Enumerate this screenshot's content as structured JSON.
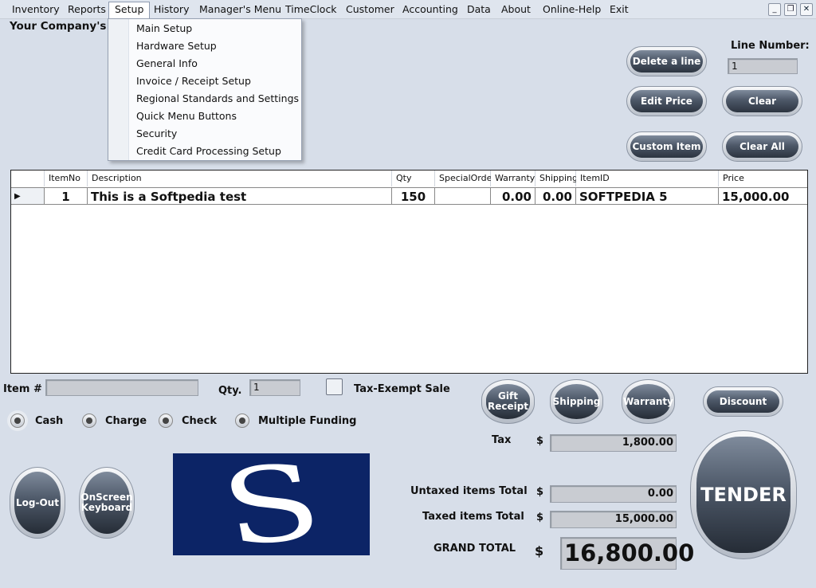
{
  "menu": {
    "items": [
      "Inventory",
      "Reports",
      "Setup",
      "History",
      "Manager's Menu",
      "TimeClock",
      "Customer",
      "Accounting",
      "Data",
      "About",
      "Online-Help",
      "Exit"
    ],
    "active": "Setup"
  },
  "window_controls": {
    "minimize": "_",
    "restore": "❐",
    "close": "✕"
  },
  "setup_menu": [
    "Main Setup",
    "Hardware Setup",
    "General Info",
    "Invoice / Receipt Setup",
    "Regional Standards and Settings",
    "Quick Menu Buttons",
    "Security",
    "Credit Card Processing Setup"
  ],
  "company_name": "Your Company's Na",
  "line_number": {
    "label": "Line Number:",
    "value": "1"
  },
  "buttons": {
    "delete_line": "Delete a line",
    "edit_price": "Edit Price",
    "clear": "Clear",
    "custom_item": "Custom Item",
    "clear_all": "Clear All",
    "gift_receipt": "Gift Receipt",
    "shipping": "Shipping",
    "warranty": "Warranty",
    "discount": "Discount",
    "logout": "Log-Out",
    "onscreen_keyboard": "OnScreen Keyboard",
    "tender": "TENDER"
  },
  "grid": {
    "columns": [
      "ItemNo",
      "Description",
      "Qty",
      "SpecialOrder",
      "Warranty",
      "Shipping",
      "ItemID",
      "Price"
    ],
    "rows": [
      {
        "itemno": "1",
        "description": "This is a Softpedia test",
        "qty": "150",
        "specialorder": "",
        "warranty": "0.00",
        "shipping": "0.00",
        "itemid": "SOFTPEDIA 5",
        "price": "15,000.00"
      }
    ]
  },
  "entry": {
    "item_label": "Item #",
    "item_value": "",
    "qty_label": "Qty.",
    "qty_value": "1",
    "tax_exempt_label": "Tax-Exempt Sale",
    "tax_exempt_checked": false
  },
  "payment": {
    "options": [
      "Cash",
      "Charge",
      "Check",
      "Multiple Funding"
    ],
    "selected": "Cash"
  },
  "totals": {
    "currency": "$",
    "tax_label": "Tax",
    "tax": "1,800.00",
    "untaxed_label": "Untaxed items Total",
    "untaxed": "0.00",
    "taxed_label": "Taxed items Total",
    "taxed": "15,000.00",
    "grand_label": "GRAND TOTAL",
    "grand": "16,800.00"
  },
  "logo": {
    "letter": "S",
    "background": "#0c2466"
  }
}
